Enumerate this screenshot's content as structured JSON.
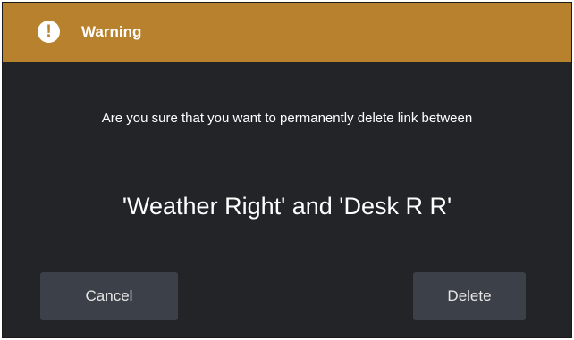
{
  "dialog": {
    "title": "Warning",
    "icon": "!",
    "message": "Are you sure that you want to permanently delete link between",
    "subject": "'Weather Right' and 'Desk R R'",
    "cancel_label": "Cancel",
    "delete_label": "Delete"
  },
  "colors": {
    "title_bar": "#b8812e",
    "body": "#222428",
    "button": "#3c4149",
    "text": "#ffffff"
  }
}
